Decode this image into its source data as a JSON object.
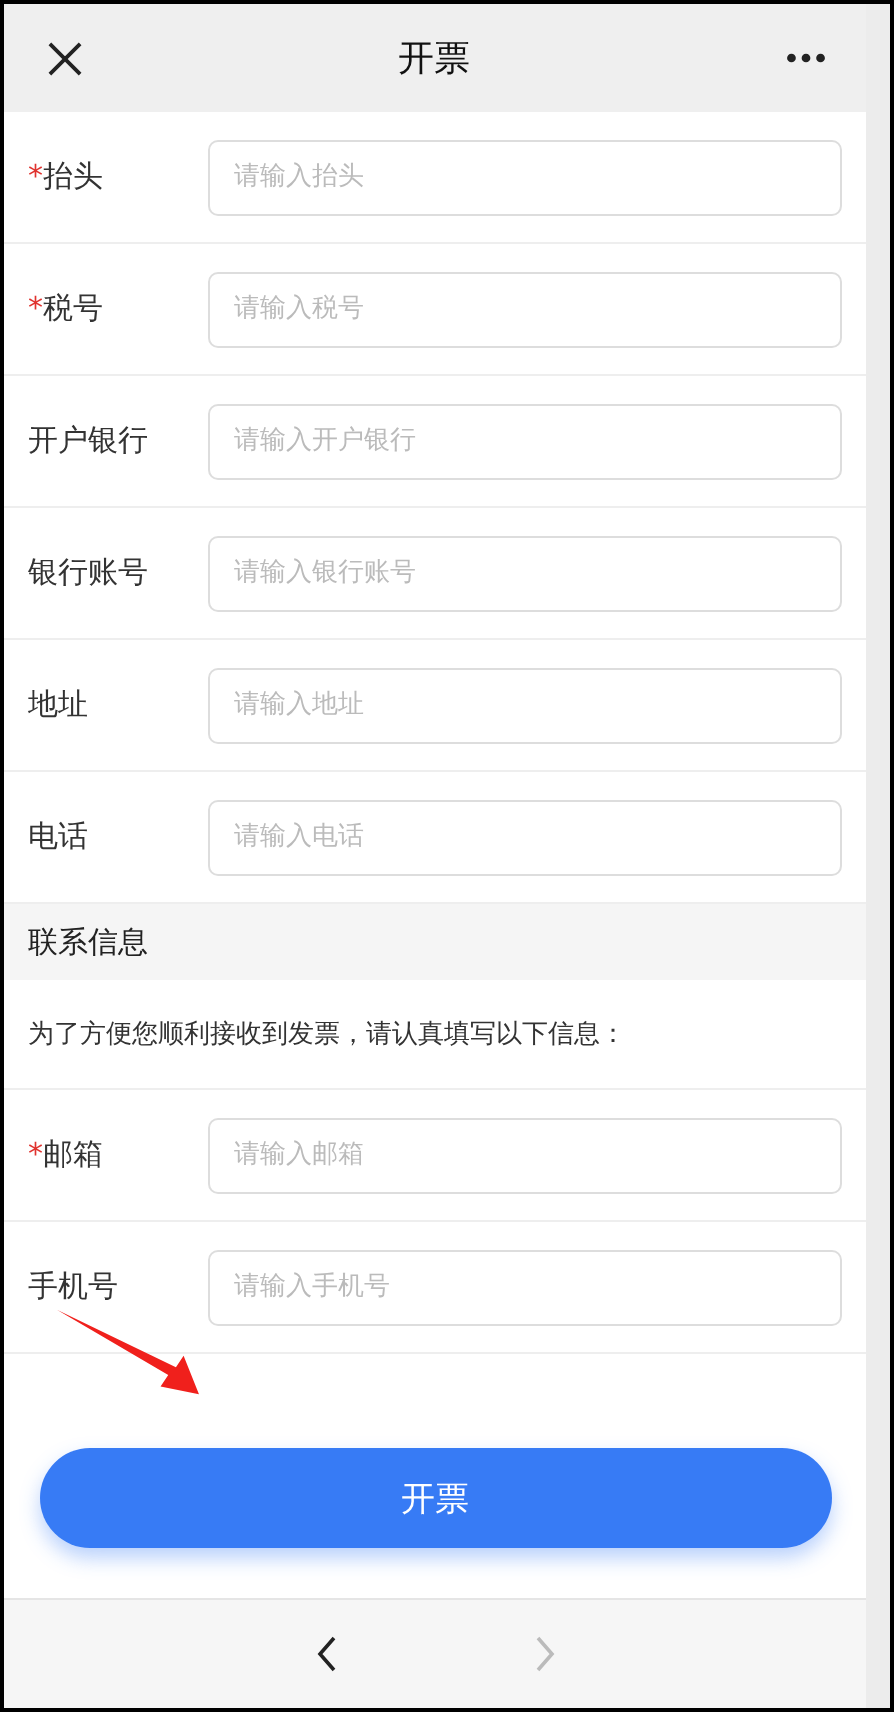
{
  "header": {
    "title": "开票"
  },
  "fields": [
    {
      "label": "抬头",
      "required_mark": "*",
      "placeholder": "请输入抬头"
    },
    {
      "label": "税号",
      "required_mark": "*",
      "placeholder": "请输入税号"
    },
    {
      "label": "开户银行",
      "placeholder": "请输入开户银行"
    },
    {
      "label": "银行账号",
      "placeholder": "请输入银行账号"
    },
    {
      "label": "地址",
      "placeholder": "请输入地址"
    },
    {
      "label": "电话",
      "placeholder": "请输入电话"
    }
  ],
  "contact": {
    "heading": "联系信息",
    "note": "为了方便您顺利接收到发票，请认真填写以下信息：",
    "fields": [
      {
        "label": "邮箱",
        "required_mark": "*",
        "placeholder": "请输入邮箱"
      },
      {
        "label": "手机号",
        "placeholder": "请输入手机号"
      }
    ]
  },
  "submit": "开票",
  "nav": {
    "back_disabled": false,
    "forward_disabled": true
  }
}
